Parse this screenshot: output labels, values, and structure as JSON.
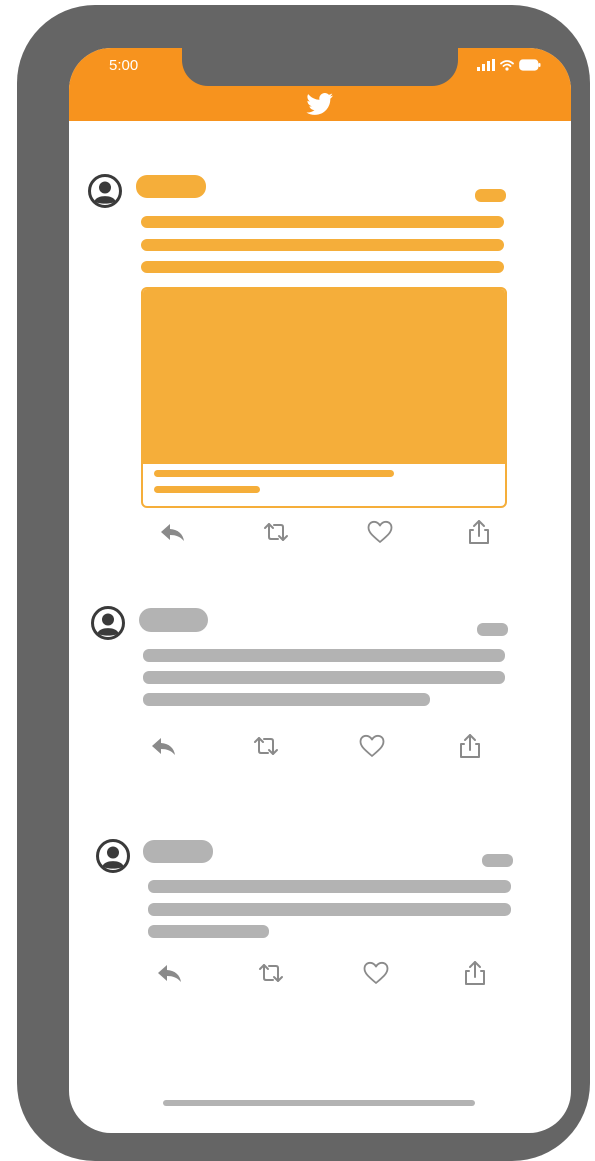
{
  "status_bar": {
    "time": "5:00"
  },
  "header": {
    "logo_icon": "twitter-bird-icon"
  },
  "colors": {
    "accent": "#f7931e",
    "highlight_placeholder": "#f5ae3a",
    "muted_placeholder": "#b3b3b3",
    "icon": "#8a8a8a",
    "frame": "#656565"
  },
  "tweets": [
    {
      "state": "highlighted",
      "has_media_card": true,
      "actions": [
        "reply-icon",
        "retweet-icon",
        "like-icon",
        "share-icon"
      ]
    },
    {
      "state": "placeholder",
      "has_media_card": false,
      "actions": [
        "reply-icon",
        "retweet-icon",
        "like-icon",
        "share-icon"
      ]
    },
    {
      "state": "placeholder",
      "has_media_card": false,
      "actions": [
        "reply-icon",
        "retweet-icon",
        "like-icon",
        "share-icon"
      ]
    }
  ]
}
